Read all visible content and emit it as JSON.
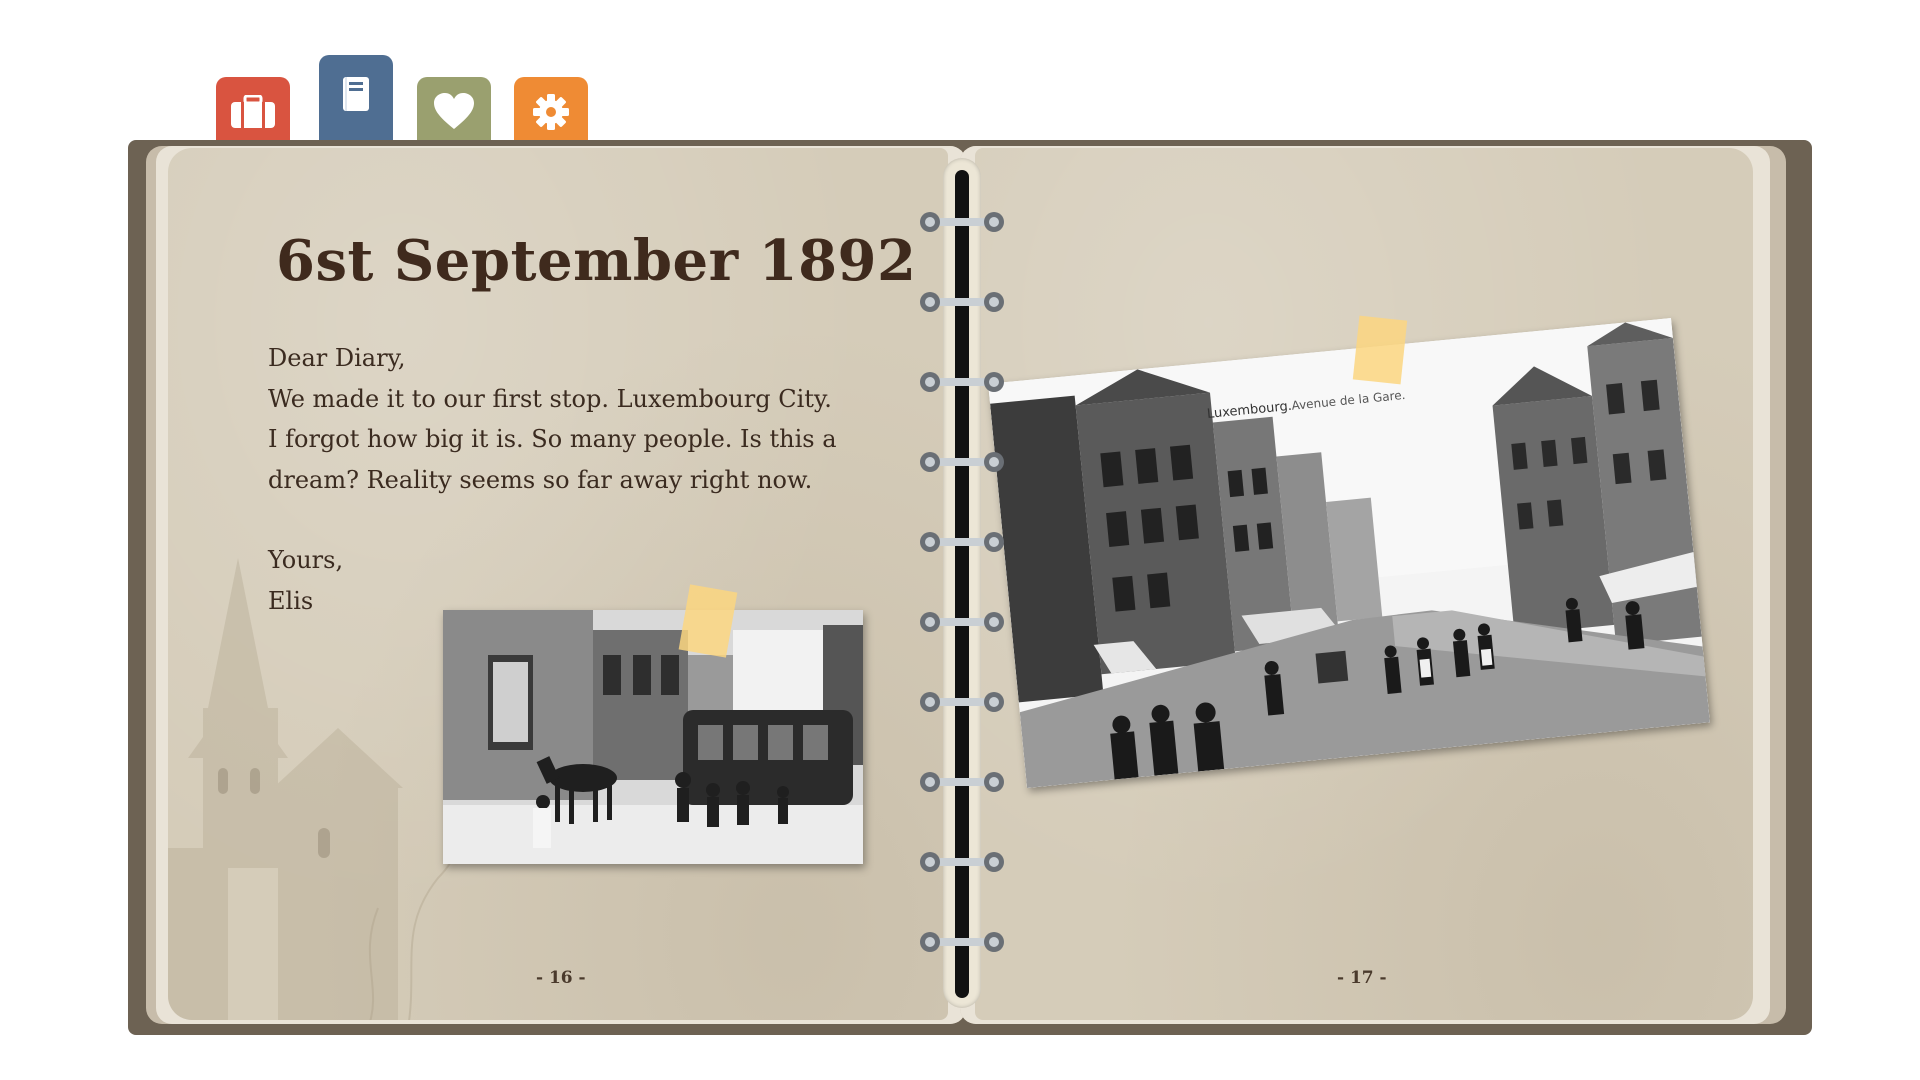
{
  "tabs": [
    {
      "name": "suitcase",
      "color": "#d95440"
    },
    {
      "name": "notebook",
      "color": "#4f6e92"
    },
    {
      "name": "heart",
      "color": "#9aa06f"
    },
    {
      "name": "gear",
      "color": "#ef8b34"
    }
  ],
  "left_page": {
    "title": "6st September 1892",
    "lines": [
      "Dear Diary,",
      "We made it to our first stop. Luxembourg City.",
      "I forgot how big it is. So many people. Is this a",
      "dream? Reality seems so far away right now."
    ],
    "closing": "Yours,",
    "signature": "Elis",
    "page_number": "- 16 -"
  },
  "right_page": {
    "page_number": "- 17 -",
    "postcard_caption_1": "Luxembourg.",
    "postcard_caption_2": "Avenue de la Gare."
  },
  "colors": {
    "cover": "#6d6253",
    "page": "#d5ccb9",
    "ink": "#3b2b20",
    "tape": "#fcd680"
  }
}
